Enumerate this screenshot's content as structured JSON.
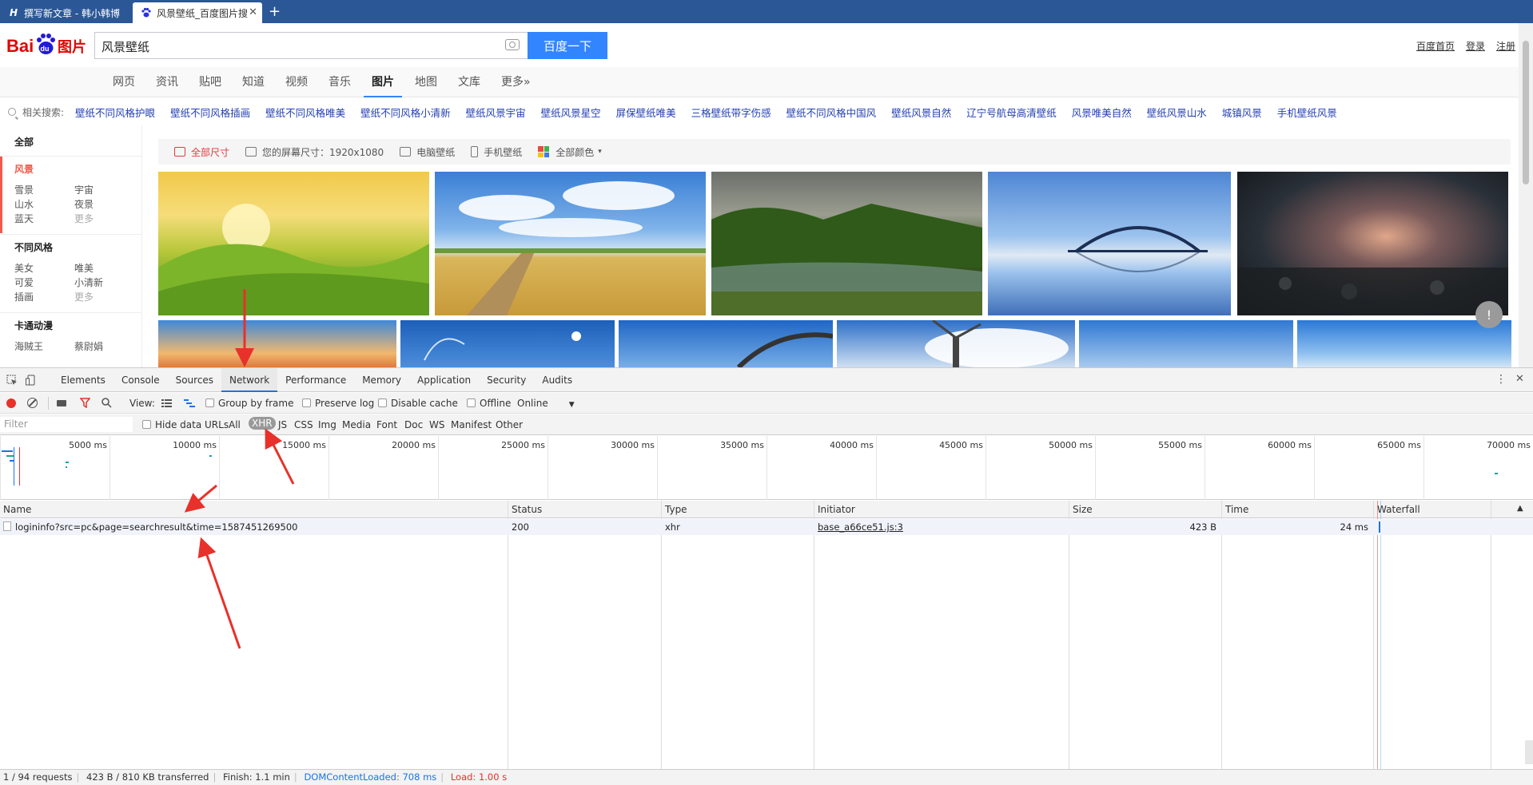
{
  "browser": {
    "tabs": [
      {
        "title": "撰写新文章 - 韩小韩博",
        "active": false
      },
      {
        "title": "风景壁纸_百度图片搜",
        "active": true
      }
    ]
  },
  "baidu": {
    "logo_text": "Bai",
    "logo_paw": "du",
    "logo_suffix": "图片",
    "search_value": "风景壁纸",
    "search_button": "百度一下",
    "top_links": [
      "百度首页",
      "登录",
      "注册"
    ],
    "nav": [
      "网页",
      "资讯",
      "贴吧",
      "知道",
      "视频",
      "音乐",
      "图片",
      "地图",
      "文库",
      "更多»"
    ],
    "nav_active": "图片",
    "related_label": "相关搜索:",
    "related_links": [
      "壁纸不同风格护眼",
      "壁纸不同风格插画",
      "壁纸不同风格唯美",
      "壁纸不同风格小清新",
      "壁纸风景宇宙",
      "壁纸风景星空",
      "屏保壁纸唯美",
      "三格壁纸带字伤感",
      "壁纸不同风格中国风",
      "壁纸风景自然",
      "辽宁号航母高清壁纸",
      "风景唯美自然",
      "壁纸风景山水",
      "城镇风景",
      "手机壁纸风景"
    ],
    "sidebar": {
      "all": "全部",
      "groups": [
        {
          "title": "风景",
          "items": [
            "雪景",
            "宇宙",
            "山水",
            "夜景",
            "蓝天",
            "更多"
          ]
        },
        {
          "title": "不同风格",
          "items": [
            "美女",
            "唯美",
            "可爱",
            "小清新",
            "插画",
            "更多"
          ]
        },
        {
          "title": "卡通动漫",
          "items": [
            "海贼王",
            "蔡尉娟"
          ]
        }
      ]
    },
    "filters": [
      "全部尺寸",
      "您的屏幕尺寸：1920x1080",
      "电脑壁纸",
      "手机壁纸",
      "全部颜色"
    ],
    "feedback": "!"
  },
  "devtools": {
    "tabs": [
      "Elements",
      "Console",
      "Sources",
      "Network",
      "Performance",
      "Memory",
      "Application",
      "Security",
      "Audits"
    ],
    "active_tab": "Network",
    "toolbar": {
      "view_label": "View:",
      "group_by_frame": "Group by frame",
      "preserve_log": "Preserve log",
      "disable_cache": "Disable cache",
      "offline": "Offline",
      "throttle": "Online"
    },
    "filter": {
      "placeholder": "Filter",
      "hide_data_urls": "Hide data URLs",
      "types": [
        "All",
        "XHR",
        "JS",
        "CSS",
        "Img",
        "Media",
        "Font",
        "Doc",
        "WS",
        "Manifest",
        "Other"
      ],
      "active_type": "XHR"
    },
    "timeline_ticks": [
      "5000 ms",
      "10000 ms",
      "15000 ms",
      "20000 ms",
      "25000 ms",
      "30000 ms",
      "35000 ms",
      "40000 ms",
      "45000 ms",
      "50000 ms",
      "55000 ms",
      "60000 ms",
      "65000 ms",
      "70000 ms"
    ],
    "columns": [
      "Name",
      "Status",
      "Type",
      "Initiator",
      "Size",
      "Time",
      "Waterfall"
    ],
    "rows": [
      {
        "name": "logininfo?src=pc&page=searchresult&time=1587451269500",
        "status": "200",
        "type": "xhr",
        "initiator": "base_a66ce51.js:3",
        "size": "423 B",
        "time": "24 ms"
      }
    ],
    "status_bar": {
      "requests": "1 / 94 requests",
      "transferred": "423 B / 810 KB transferred",
      "finish": "Finish: 1.1 min",
      "dom_loaded": "DOMContentLoaded: 708 ms",
      "load": "Load: 1.00 s"
    }
  },
  "colors": {
    "baidu_blue": "#3385ff",
    "link_blue": "#2440b3",
    "annotation_red": "#e8312a",
    "devtools_blue": "#1a73e8"
  }
}
